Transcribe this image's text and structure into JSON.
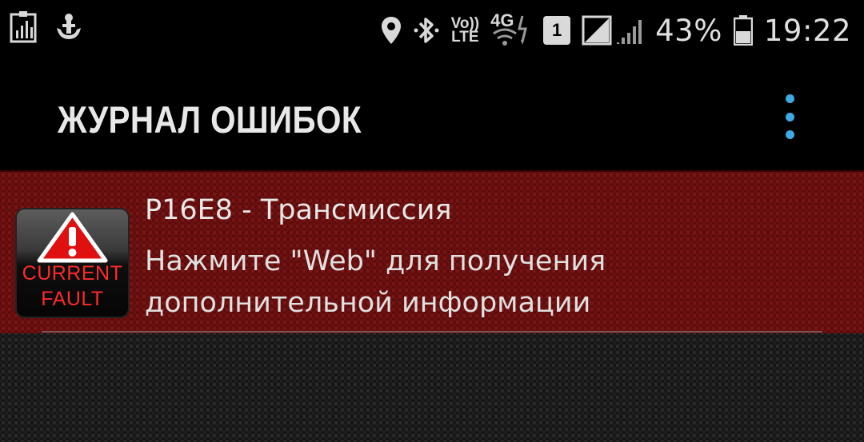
{
  "status_bar": {
    "left_icons": [
      "stats-icon",
      "anchor-icon"
    ],
    "volte_top": "Vo))",
    "volte_bottom": "LTE",
    "network": "4G",
    "sim": "1",
    "battery": "43%",
    "time": "19:22"
  },
  "app_bar": {
    "title": "ЖУРНАЛ ОШИБОК",
    "menu_icon": "more-vert-icon",
    "accent_color": "#3ea9e3"
  },
  "fault": {
    "code": "P16E8 - Трансмиссия",
    "description": "Нажмите \"Web\" для получения дополнительной информации",
    "icon_label_line1": "CURRENT",
    "icon_label_line2": "FAULT",
    "row_color": "#5a0a0a"
  }
}
